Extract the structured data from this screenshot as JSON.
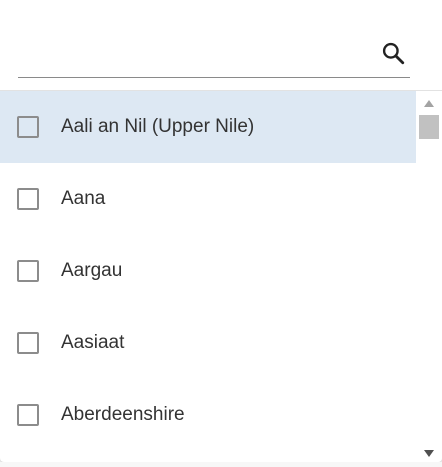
{
  "search": {
    "value": "",
    "placeholder": "",
    "icon": "search-icon"
  },
  "items": [
    {
      "label": "Aali an Nil (Upper Nile)",
      "checked": false,
      "highlighted": true
    },
    {
      "label": "Aana",
      "checked": false,
      "highlighted": false
    },
    {
      "label": "Aargau",
      "checked": false,
      "highlighted": false
    },
    {
      "label": "Aasiaat",
      "checked": false,
      "highlighted": false
    },
    {
      "label": "Aberdeenshire",
      "checked": false,
      "highlighted": false
    }
  ],
  "colors": {
    "highlight": "#dde8f3",
    "checkbox_border": "#8c8c8c",
    "text": "#333333",
    "scroll_thumb": "#c1c1c1"
  }
}
